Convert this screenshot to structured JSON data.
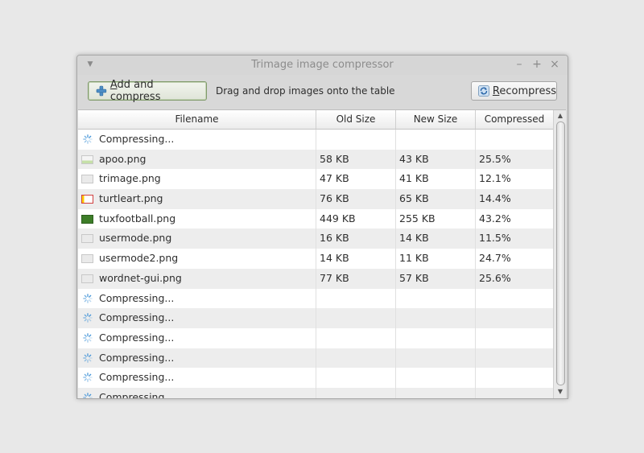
{
  "window": {
    "title": "Trimage image compressor"
  },
  "toolbar": {
    "add_label_accel": "A",
    "add_label_rest": "dd and compress",
    "hint": "Drag and drop images onto the table",
    "recompress_label_accel": "R",
    "recompress_label_rest": "ecompress"
  },
  "table": {
    "headers": {
      "filename": "Filename",
      "old_size": "Old Size",
      "new_size": "New Size",
      "compressed": "Compressed"
    },
    "rows": [
      {
        "status": "compressing",
        "filename": "Compressing...",
        "old": "",
        "new": "",
        "comp": "",
        "icon": "spinner-icon"
      },
      {
        "status": "done",
        "filename": "apoo.png",
        "old": "58 KB",
        "new": "43 KB",
        "comp": "25.5%",
        "icon": "image-thumbnail-icon"
      },
      {
        "status": "done",
        "filename": "trimage.png",
        "old": "47 KB",
        "new": "41 KB",
        "comp": "12.1%",
        "icon": "image-thumbnail-icon"
      },
      {
        "status": "done",
        "filename": "turtleart.png",
        "old": "76 KB",
        "new": "65 KB",
        "comp": "14.4%",
        "icon": "image-thumbnail-icon"
      },
      {
        "status": "done",
        "filename": "tuxfootball.png",
        "old": "449 KB",
        "new": "255 KB",
        "comp": "43.2%",
        "icon": "image-thumbnail-icon"
      },
      {
        "status": "done",
        "filename": "usermode.png",
        "old": "16 KB",
        "new": "14 KB",
        "comp": "11.5%",
        "icon": "image-thumbnail-icon"
      },
      {
        "status": "done",
        "filename": "usermode2.png",
        "old": "14 KB",
        "new": "11 KB",
        "comp": "24.7%",
        "icon": "image-thumbnail-icon"
      },
      {
        "status": "done",
        "filename": "wordnet-gui.png",
        "old": "77 KB",
        "new": "57 KB",
        "comp": "25.6%",
        "icon": "image-thumbnail-icon"
      },
      {
        "status": "compressing",
        "filename": "Compressing...",
        "old": "",
        "new": "",
        "comp": "",
        "icon": "spinner-icon"
      },
      {
        "status": "compressing",
        "filename": "Compressing...",
        "old": "",
        "new": "",
        "comp": "",
        "icon": "spinner-icon"
      },
      {
        "status": "compressing",
        "filename": "Compressing...",
        "old": "",
        "new": "",
        "comp": "",
        "icon": "spinner-icon"
      },
      {
        "status": "compressing",
        "filename": "Compressing...",
        "old": "",
        "new": "",
        "comp": "",
        "icon": "spinner-icon"
      },
      {
        "status": "compressing",
        "filename": "Compressing...",
        "old": "",
        "new": "",
        "comp": "",
        "icon": "spinner-icon"
      },
      {
        "status": "compressing",
        "filename": "Compressing...",
        "old": "",
        "new": "",
        "comp": "",
        "icon": "spinner-icon"
      }
    ]
  },
  "colors": {
    "spinner": "#3a8fd6",
    "add_button_border": "#7f9a6a",
    "alt_row": "#ededed"
  }
}
